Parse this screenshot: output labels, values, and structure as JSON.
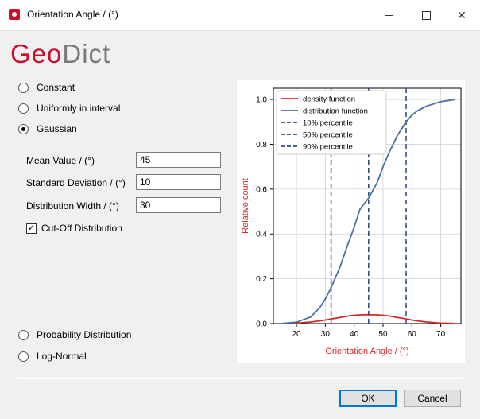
{
  "window": {
    "title": "Orientation Angle / (°)",
    "controls": [
      "minimize-icon",
      "maximize-icon",
      "close-icon"
    ]
  },
  "logo": {
    "part1": "Geo",
    "part2": "Dict"
  },
  "options": {
    "constant": "Constant",
    "uniform": "Uniformly in interval",
    "gaussian": "Gaussian",
    "probability": "Probability Distribution",
    "lognormal": "Log-Normal",
    "selected": "gaussian"
  },
  "fields": {
    "mean": {
      "label": "Mean Value / (°)",
      "value": "45"
    },
    "std": {
      "label": "Standard Deviation / (°)",
      "value": "10"
    },
    "width": {
      "label": "Distribution Width / (°)",
      "value": "30"
    }
  },
  "cutoff": {
    "label": "Cut-Off Distribution",
    "checked": true
  },
  "buttons": {
    "ok": "OK",
    "cancel": "Cancel"
  },
  "colors": {
    "brand": "#c8102e",
    "density": "#d62728",
    "distribution": "#4a6fa0",
    "percentile": "#2f4f7f"
  },
  "chart_data": {
    "type": "line",
    "xlabel": "Orientation Angle / (°)",
    "ylabel": "Relative count",
    "xlim": [
      12,
      77
    ],
    "ylim": [
      0,
      1.05
    ],
    "xticks": [
      20,
      30,
      40,
      50,
      60,
      70
    ],
    "yticks": [
      0.0,
      0.2,
      0.4,
      0.6,
      0.8,
      1.0
    ],
    "grid": true,
    "legend_position": "top-left",
    "x": [
      15,
      20,
      25,
      28,
      30,
      32,
      35,
      38,
      40,
      42,
      45,
      48,
      50,
      52,
      55,
      58,
      60,
      62,
      65,
      70,
      75
    ],
    "series": [
      {
        "name": "density function",
        "style": "solid",
        "color": "#d62728",
        "values": [
          0.0002,
          0.002,
          0.007,
          0.012,
          0.016,
          0.021,
          0.027,
          0.034,
          0.037,
          0.039,
          0.04,
          0.039,
          0.037,
          0.034,
          0.027,
          0.021,
          0.016,
          0.012,
          0.007,
          0.002,
          0.0002
        ]
      },
      {
        "name": "distribution function",
        "style": "solid",
        "color": "#4a6fa0",
        "values": [
          0.001,
          0.006,
          0.03,
          0.07,
          0.11,
          0.16,
          0.25,
          0.36,
          0.43,
          0.51,
          0.56,
          0.63,
          0.7,
          0.76,
          0.84,
          0.9,
          0.93,
          0.95,
          0.97,
          0.99,
          1.0
        ]
      }
    ],
    "percentiles": [
      {
        "name": "10% percentile",
        "x": 32
      },
      {
        "name": "50% percentile",
        "x": 45
      },
      {
        "name": "90% percentile",
        "x": 58
      }
    ]
  }
}
